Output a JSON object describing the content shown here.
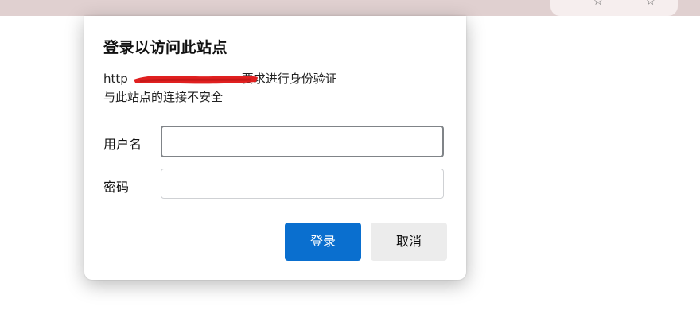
{
  "browser": {
    "toolbar_icons": [
      "star-outline-icon",
      "favorites-star-icon"
    ]
  },
  "dialog": {
    "title": "登录以访问此站点",
    "url_prefix": "http",
    "url_suffix": "要求进行身份验证",
    "insecure_warning": "与此站点的连接不安全",
    "username_label": "用户名",
    "username_value": "",
    "password_label": "密码",
    "password_value": "",
    "login_button": "登录",
    "cancel_button": "取消"
  },
  "colors": {
    "primary_button": "#0a6fcf",
    "redaction": "#e02020"
  }
}
